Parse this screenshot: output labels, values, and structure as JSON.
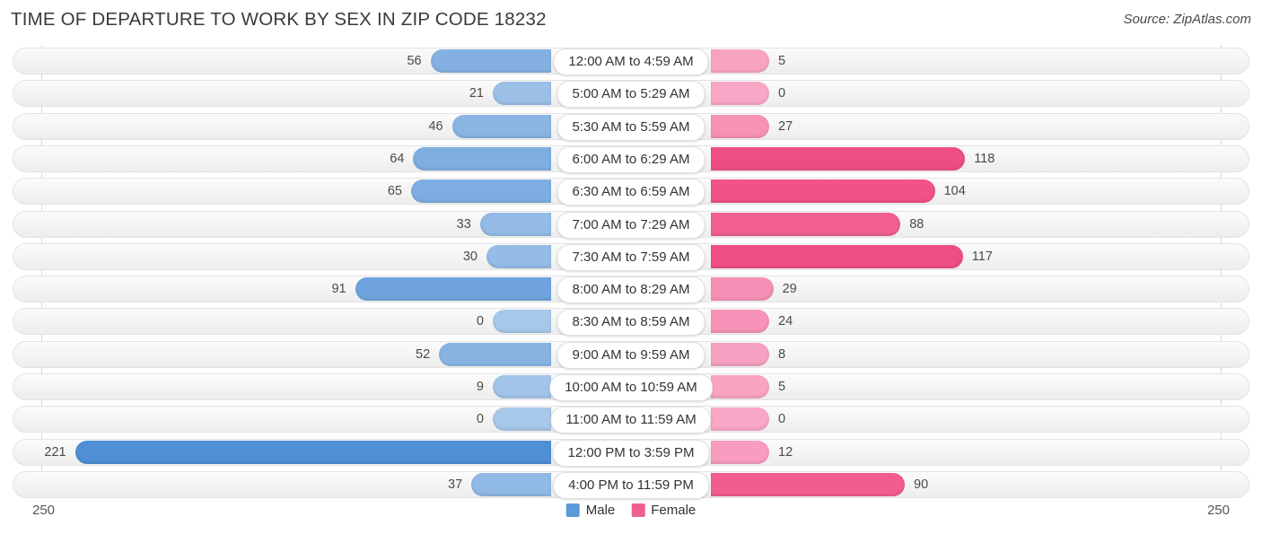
{
  "header": {
    "title": "TIME OF DEPARTURE TO WORK BY SEX IN ZIP CODE 18232",
    "source": "Source: ZipAtlas.com"
  },
  "legend": {
    "male_label": "Male",
    "female_label": "Female",
    "male_color": "#5b9bd5",
    "female_color": "#ef5f90"
  },
  "axis": {
    "left_tick": "250",
    "right_tick": "250"
  },
  "chart_data": {
    "type": "bar",
    "orientation": "horizontal-diverging",
    "title": "TIME OF DEPARTURE TO WORK BY SEX IN ZIP CODE 18232",
    "subtitle": "Source: ZipAtlas.com",
    "xlabel": "",
    "ylabel": "",
    "xlim": [
      250,
      250
    ],
    "axis_max": 250,
    "grid": false,
    "legend_position": "bottom-center",
    "categories": [
      "12:00 AM to 4:59 AM",
      "5:00 AM to 5:29 AM",
      "5:30 AM to 5:59 AM",
      "6:00 AM to 6:29 AM",
      "6:30 AM to 6:59 AM",
      "7:00 AM to 7:29 AM",
      "7:30 AM to 7:59 AM",
      "8:00 AM to 8:29 AM",
      "8:30 AM to 8:59 AM",
      "9:00 AM to 9:59 AM",
      "10:00 AM to 10:59 AM",
      "11:00 AM to 11:59 AM",
      "12:00 PM to 3:59 PM",
      "4:00 PM to 11:59 PM"
    ],
    "series": [
      {
        "name": "Male",
        "color": "#5b9bd5",
        "values": [
          56,
          21,
          46,
          64,
          65,
          33,
          30,
          91,
          0,
          52,
          9,
          0,
          221,
          37
        ]
      },
      {
        "name": "Female",
        "color": "#ef5f90",
        "values": [
          5,
          0,
          27,
          118,
          104,
          88,
          117,
          29,
          24,
          8,
          5,
          0,
          12,
          90
        ]
      }
    ]
  }
}
